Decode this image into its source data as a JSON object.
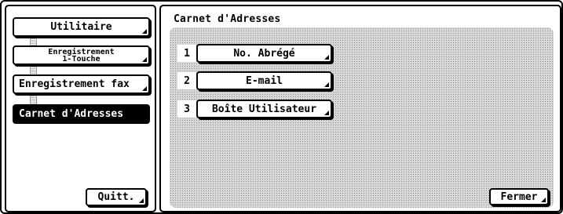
{
  "sidebar": {
    "items": [
      {
        "label": "Utilitaire"
      },
      {
        "label_line1": "Enregistrement",
        "label_line2": "1-Touche"
      },
      {
        "label": "Enregistrement fax"
      },
      {
        "label": "Carnet d'Adresses"
      }
    ],
    "quit_label": "Quitt."
  },
  "main": {
    "title": "Carnet d'Adresses",
    "options": [
      {
        "number": "1",
        "label": "No. Abrégé"
      },
      {
        "number": "2",
        "label": "E-mail"
      },
      {
        "number": "3",
        "label": "Boîte Utilisateur"
      }
    ],
    "close_label": "Fermer"
  }
}
